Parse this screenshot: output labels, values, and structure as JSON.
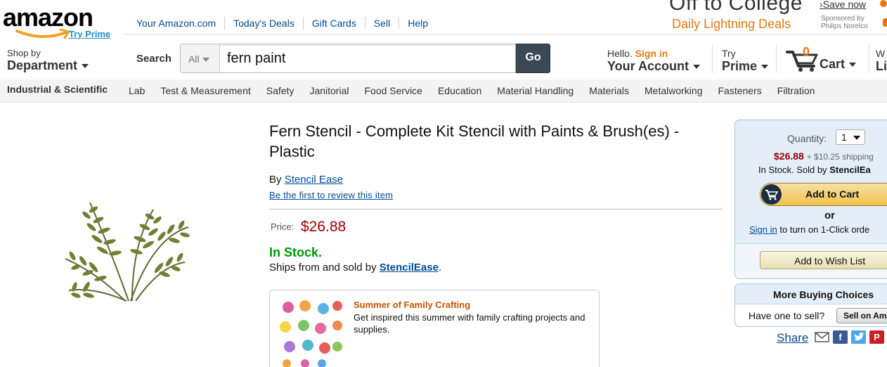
{
  "header": {
    "logo_text": "amazon",
    "try_prime": "Try Prime",
    "nav_links": [
      "Your Amazon.com",
      "Today's Deals",
      "Gift Cards",
      "Sell",
      "Help"
    ],
    "promo": {
      "headline": "Off to College",
      "deals": "Daily Lightning Deals",
      "save_now": "›Save now",
      "sponsor": "Sponsored by Philips Norelco"
    },
    "shop_by_small": "Shop by",
    "shop_by_big": "Department",
    "search_label": "Search",
    "search_scope": "All",
    "search_value": "fern paint",
    "go_label": "Go",
    "account_hello": "Hello.",
    "account_signin": "Sign in",
    "account_big": "Your Account",
    "prime_small": "Try",
    "prime_big": "Prime",
    "cart_count": "0",
    "cart_label": "Cart",
    "wish_small": "W",
    "wish_big": "Li"
  },
  "category_bar": {
    "title": "Industrial & Scientific",
    "links": [
      "Lab",
      "Test & Measurement",
      "Safety",
      "Janitorial",
      "Food Service",
      "Education",
      "Material Handling",
      "Materials",
      "Metalworking",
      "Fasteners",
      "Filtration"
    ]
  },
  "product": {
    "title": "Fern Stencil - Complete Kit Stencil with Paints & Brush(es) - Plastic",
    "by_prefix": "By",
    "brand": "Stencil Ease",
    "review_link": "Be the first to review this item",
    "price_label": "Price:",
    "price": "$26.88",
    "stock": "In Stock.",
    "ships_prefix": "Ships from and sold by",
    "seller": "StencilEase",
    "ships_suffix": "."
  },
  "promo_box": {
    "title": "Summer of Family Crafting",
    "text": "Get inspired this summer with family crafting projects and supplies."
  },
  "buy_box": {
    "quantity_label": "Quantity:",
    "quantity_value": "1",
    "price": "$26.88",
    "shipping": "+ $10.25 shipping",
    "stock_prefix": "In Stock. Sold by",
    "seller_partial": "StencilEa",
    "add_to_cart": "Add to Cart",
    "or": "or",
    "sign_in": "Sign in",
    "one_click": "to turn on 1-Click orde",
    "wish_list": "Add to Wish List"
  },
  "more_buying": {
    "title": "More Buying Choices",
    "question": "Have one to sell?",
    "sell_button": "Sell on Ama"
  },
  "share": {
    "label": "Share",
    "icons": [
      "email-icon",
      "facebook-icon",
      "twitter-icon",
      "pinterest-icon"
    ]
  },
  "colors": {
    "link": "#004b91",
    "price": "#990000",
    "in_stock": "#009900",
    "accent_orange": "#e47911"
  }
}
